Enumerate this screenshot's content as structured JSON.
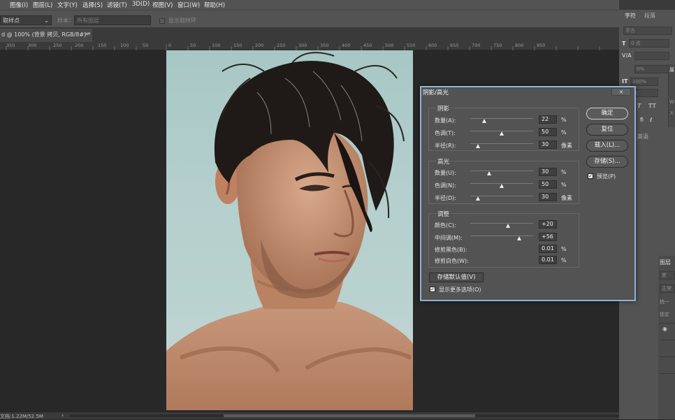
{
  "menu": [
    "图像(I)",
    "图层(L)",
    "文字(Y)",
    "选择(S)",
    "滤镜(T)",
    "3D(D)",
    "视图(V)",
    "窗口(W)",
    "帮助(H)"
  ],
  "options": {
    "sample_select": "取样点",
    "sample_label": "样本：",
    "sample_value": "所有图层",
    "show_ring": "显示取样环"
  },
  "doc_tab": {
    "title": "d @ 100% (背景 拷贝, RGB/8#) *",
    "close": "×"
  },
  "ruler_ticks": [
    "350",
    "300",
    "250",
    "200",
    "150",
    "100",
    "50",
    "0",
    "50",
    "100",
    "150",
    "200",
    "250",
    "300",
    "350",
    "400",
    "450",
    "500",
    "550",
    "600",
    "650",
    "700",
    "750",
    "800",
    "850"
  ],
  "status": {
    "doc_info": "文档:1.22M/52.5M"
  },
  "right_panel": {
    "tab_char": "字符",
    "tab_para": "段落",
    "font_style": "平方",
    "size_val": "0 点",
    "tracking_val": "0%",
    "scale_val": "100%",
    "baseline_val": "点",
    "lang": "英语",
    "layers_tab": "图层",
    "search": "类",
    "normal": "正常",
    "unify": "统一",
    "lock": "锁定",
    "side_label_1": "属",
    "side_label_2": "W",
    "side_label_3": "X"
  },
  "dialog": {
    "title": "阴影/高光",
    "close": "×",
    "shadows": {
      "title": "阴影",
      "amount_label": "数量(A):",
      "amount": "22",
      "tone_label": "色调(T):",
      "tone": "50",
      "radius_label": "半径(R):",
      "radius": "30"
    },
    "highlights": {
      "title": "高光",
      "amount_label": "数量(U):",
      "amount": "30",
      "tone_label": "色调(N):",
      "tone": "50",
      "radius_label": "半径(D):",
      "radius": "30"
    },
    "adjust": {
      "title": "调整",
      "color_label": "颜色(C):",
      "color": "+20",
      "midtone_label": "中间调(M):",
      "midtone": "+56",
      "clip_black_label": "修剪黑色(B):",
      "clip_black": "0.01",
      "clip_white_label": "修剪白色(W):",
      "clip_white": "0.01"
    },
    "units": {
      "percent": "%",
      "pixels": "像素"
    },
    "buttons": {
      "ok": "确定",
      "reset": "复位",
      "load": "载入(L)...",
      "save": "存储(S)..."
    },
    "preview": "预览(P)",
    "save_defaults": "存储默认值(V)",
    "more_options": "显示更多选项(O)",
    "slider_levels": {
      "shadows_amount": 0.22,
      "shadows_tone": 0.5,
      "shadows_radius": 0.12,
      "highlights_amount": 0.3,
      "highlights_tone": 0.5,
      "highlights_radius": 0.12,
      "color": 0.6,
      "midtone": 0.78
    }
  }
}
